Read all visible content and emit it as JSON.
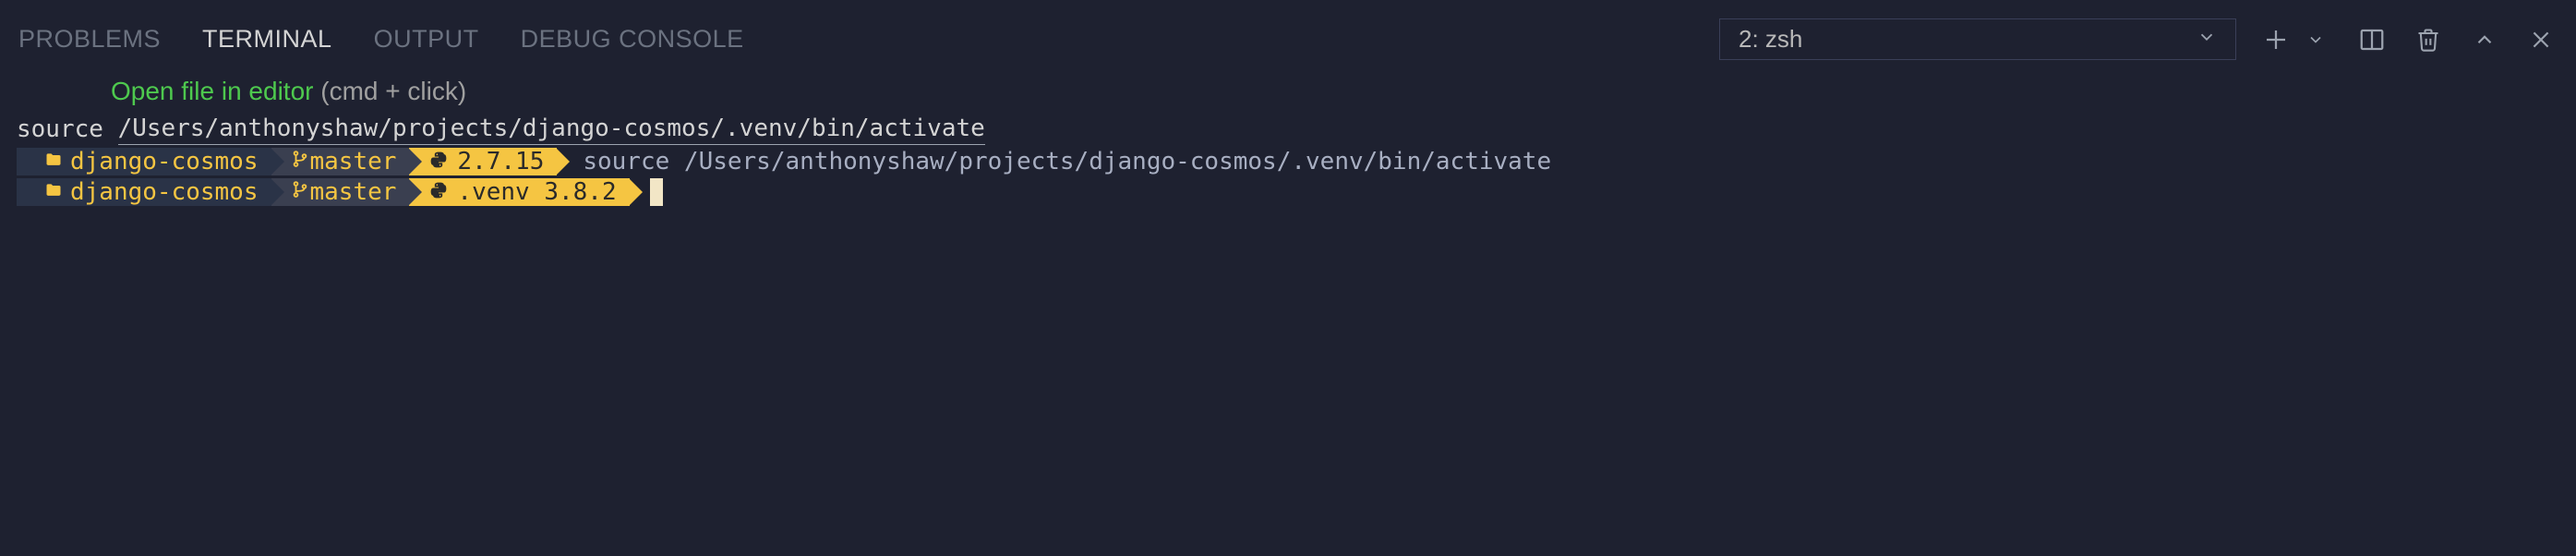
{
  "tabs": {
    "problems": "PROBLEMS",
    "terminal": "TERMINAL",
    "output": "OUTPUT",
    "debug_console": "DEBUG CONSOLE"
  },
  "terminal_selector": {
    "label": "2: zsh"
  },
  "tooltip": {
    "action": "Open file in editor",
    "hint": "(cmd + click)"
  },
  "terminal": {
    "line1": {
      "source": "source ",
      "path": "/Users/anthonyshaw/projects/django-cosmos/.venv/bin/activate"
    },
    "prompt1": {
      "dir": "django-cosmos",
      "branch": "master",
      "python": "2.7.15",
      "command": "source /Users/anthonyshaw/projects/django-cosmos/.venv/bin/activate"
    },
    "prompt2": {
      "dir": "django-cosmos",
      "branch": "master",
      "python": ".venv 3.8.2"
    }
  },
  "icons": {
    "folder": "folder-icon",
    "branch": "branch-icon",
    "python": "python-icon",
    "chevron_down": "chevron-down-icon",
    "plus": "plus-icon",
    "split": "split-icon",
    "trash": "trash-icon",
    "chevron_up": "chevron-up-icon",
    "close": "close-icon"
  }
}
